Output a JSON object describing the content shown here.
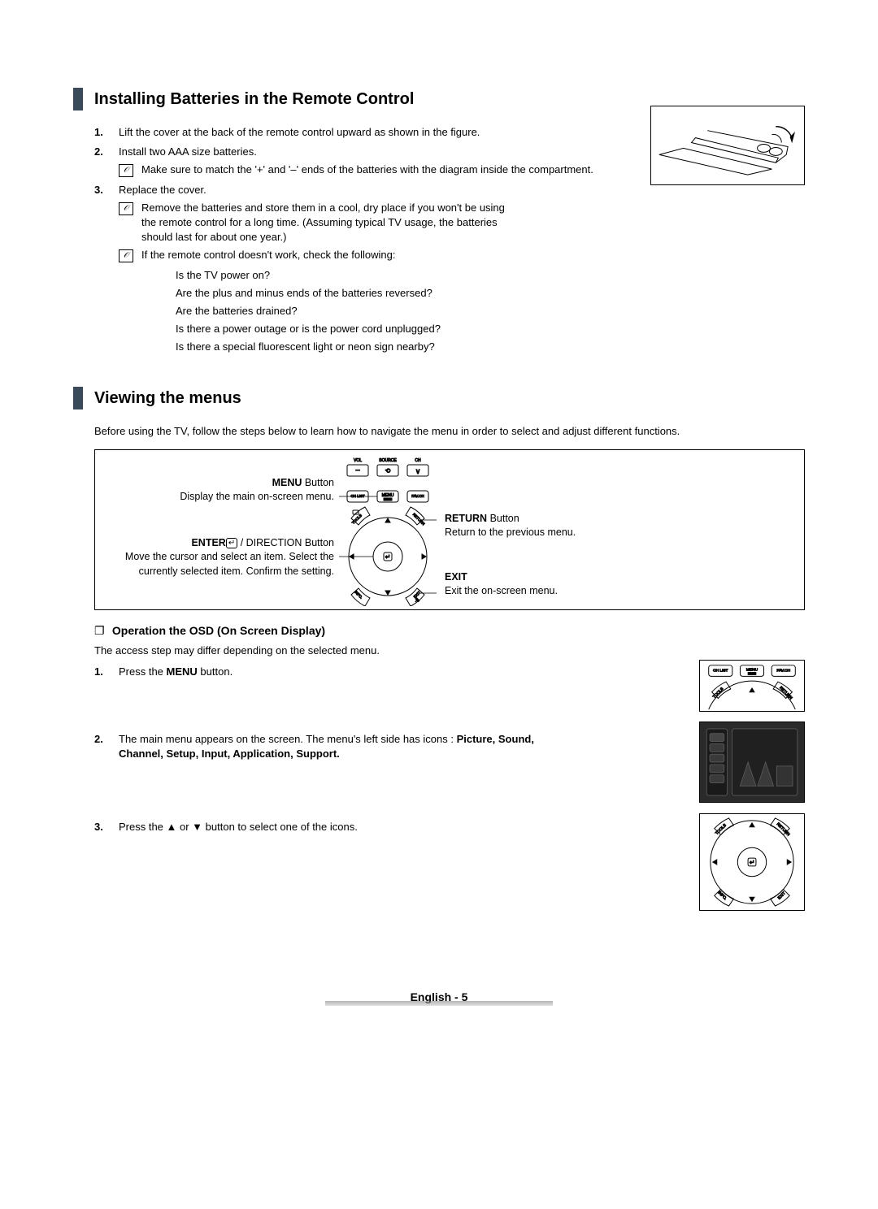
{
  "sections": {
    "batteries": {
      "title": "Installing Batteries in the Remote Control",
      "items": [
        "Lift the cover at the back of the remote control upward as shown in the figure.",
        "Install two AAA size batteries.",
        "Replace the cover."
      ],
      "note_match": "Make sure to match the '+' and '–' ends of the batteries with the diagram inside the compartment.",
      "note_store": "Remove the batteries and store them in a cool, dry place if you won't be using the remote control for a long time. (Assuming typical TV usage, the batteries should last for about one year.)",
      "note_check_intro": "If the remote control doesn't work, check the following:",
      "checks": [
        "Is the TV power on?",
        "Are the plus and minus ends of the batteries reversed?",
        "Are the batteries drained?",
        "Is there a power outage or is the power cord unplugged?",
        "Is there a special fluorescent light or neon sign nearby?"
      ]
    },
    "menus": {
      "title": "Viewing the menus",
      "intro": "Before using the TV, follow the steps below to learn how to navigate the menu in order to select and adjust different functions.",
      "labels": {
        "menu_title": "MENU",
        "menu_suffix": " Button",
        "menu_desc": "Display the main on-screen menu.",
        "enter_title": "ENTER",
        "enter_suffix": " / DIRECTION Button",
        "enter_desc": "Move the cursor and select an item. Select the currently selected item. Confirm the setting.",
        "return_title": "RETURN",
        "return_suffix": " Button",
        "return_desc": "Return to the previous menu.",
        "exit_title": "EXIT",
        "exit_desc": "Exit the on-screen menu."
      },
      "remote_labels": {
        "vol": "VOL",
        "source": "SOURCE",
        "ch": "CH",
        "chlist": "CH LIST",
        "menu": "MENU",
        "favch": "FAV.CH",
        "tools": "TOOLS",
        "return": "RETURN",
        "info": "INFO.",
        "exit": "EXIT"
      },
      "osd": {
        "heading": "Operation the OSD (On Screen Display)",
        "access": "The access step may differ depending on the selected menu.",
        "step1_pre": "Press the ",
        "step1_bold": "MENU",
        "step1_post": " button.",
        "step2_pre": "The main menu appears on the screen. The menu's left side has icons : ",
        "step2_bold": "Picture, Sound, Channel, Setup, Input, Application, Support.",
        "step3": "Press the ▲ or ▼ button to select one of the icons."
      }
    }
  },
  "footer": "English - 5"
}
